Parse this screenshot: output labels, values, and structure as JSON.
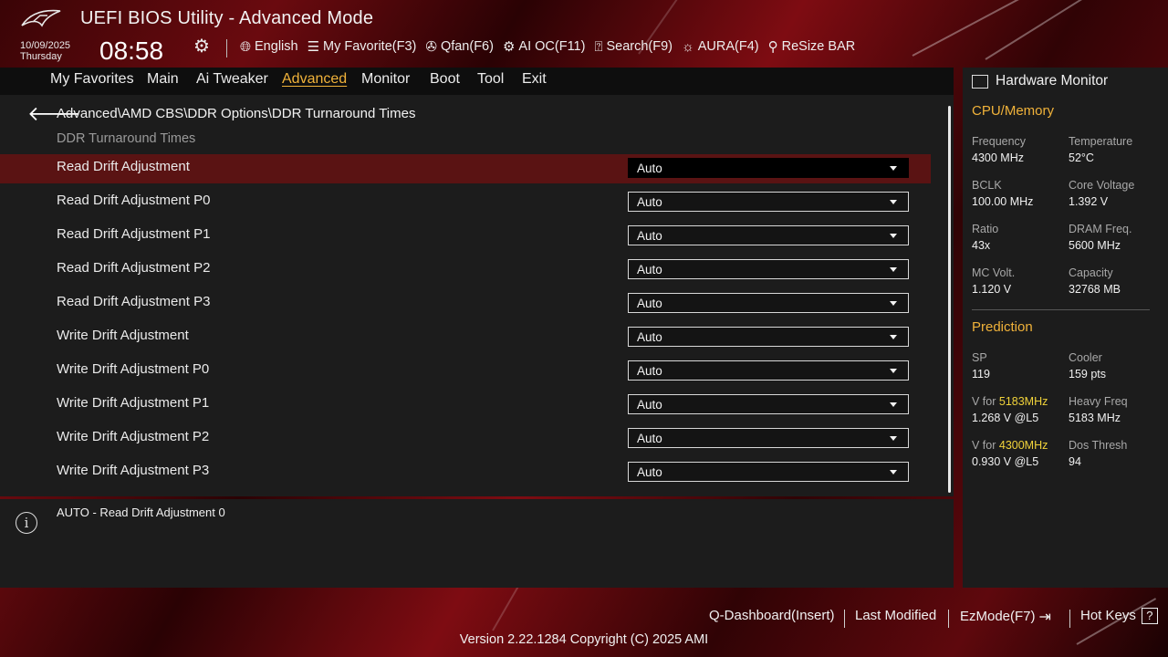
{
  "header": {
    "title": "UEFI BIOS Utility - Advanced Mode",
    "date": "10/09/2025",
    "weekday": "Thursday",
    "time": "08:58",
    "toolbar": [
      {
        "icon": "globe-icon",
        "label": "English"
      },
      {
        "icon": "favorites-list-icon",
        "label": "My Favorite(F3)"
      },
      {
        "icon": "fan-icon",
        "label": "Qfan(F6)"
      },
      {
        "icon": "chip-icon",
        "label": "AI OC(F11)"
      },
      {
        "icon": "question-box-icon",
        "label": "Search(F9)"
      },
      {
        "icon": "aura-sun-icon",
        "label": "AURA(F4)"
      },
      {
        "icon": "resize-bar-icon",
        "label": "ReSize BAR"
      }
    ]
  },
  "tabs": [
    {
      "label": "My Favorites",
      "active": false
    },
    {
      "label": "Main",
      "active": false
    },
    {
      "label": "Ai Tweaker",
      "active": false
    },
    {
      "label": "Advanced",
      "active": true
    },
    {
      "label": "Monitor",
      "active": false
    },
    {
      "label": "Boot",
      "active": false
    },
    {
      "label": "Tool",
      "active": false
    },
    {
      "label": "Exit",
      "active": false
    }
  ],
  "main": {
    "breadcrumb": "Advanced\\AMD CBS\\DDR Options\\DDR Turnaround Times",
    "section_title": "DDR Turnaround Times",
    "settings": [
      {
        "label": "Read Drift Adjustment",
        "value": "Auto",
        "selected": true
      },
      {
        "label": "Read Drift Adjustment P0",
        "value": "Auto"
      },
      {
        "label": "Read Drift Adjustment P1",
        "value": "Auto"
      },
      {
        "label": "Read Drift Adjustment P2",
        "value": "Auto"
      },
      {
        "label": "Read Drift Adjustment P3",
        "value": "Auto"
      },
      {
        "label": "Write Drift Adjustment",
        "value": "Auto"
      },
      {
        "label": "Write Drift Adjustment P0",
        "value": "Auto"
      },
      {
        "label": "Write Drift Adjustment P1",
        "value": "Auto"
      },
      {
        "label": "Write Drift Adjustment P2",
        "value": "Auto"
      },
      {
        "label": "Write Drift Adjustment P3",
        "value": "Auto"
      }
    ]
  },
  "help": {
    "text": "AUTO - Read Drift Adjustment 0"
  },
  "hw_monitor": {
    "title": "Hardware Monitor",
    "cpu_memory": {
      "heading": "CPU/Memory",
      "frequency_label": "Frequency",
      "frequency_value": "4300 MHz",
      "temperature_label": "Temperature",
      "temperature_value": "52°C",
      "bclk_label": "BCLK",
      "bclk_value": "100.00 MHz",
      "core_voltage_label": "Core Voltage",
      "core_voltage_value": "1.392 V",
      "ratio_label": "Ratio",
      "ratio_value": "43x",
      "dram_freq_label": "DRAM Freq.",
      "dram_freq_value": "5600 MHz",
      "mc_volt_label": "MC Volt.",
      "mc_volt_value": "1.120 V",
      "capacity_label": "Capacity",
      "capacity_value": "32768 MB"
    },
    "prediction": {
      "heading": "Prediction",
      "sp_label": "SP",
      "sp_value": "119",
      "cooler_label": "Cooler",
      "cooler_value": "159 pts",
      "v1_label_prefix": "V for ",
      "v1_freq": "5183MHz",
      "v1_value": "1.268 V @L5",
      "heavy_freq_label": "Heavy Freq",
      "heavy_freq_value": "5183 MHz",
      "v2_label_prefix": "V for ",
      "v2_freq": "4300MHz",
      "v2_value": "0.930 V @L5",
      "dos_thresh_label": "Dos Thresh",
      "dos_thresh_value": "94"
    }
  },
  "footer": {
    "q_dashboard": "Q-Dashboard(Insert)",
    "last_modified": "Last Modified",
    "ezmode": "EzMode(F7)",
    "hot_keys": "Hot Keys",
    "hot_keys_icon": "?",
    "version": "Version 2.22.1284 Copyright (C) 2025 AMI"
  },
  "colors": {
    "accent": "#f0b23a",
    "selected_row": "#5a1313",
    "panel": "#1c1c1c",
    "highlight_freq": "#f0d23a"
  }
}
